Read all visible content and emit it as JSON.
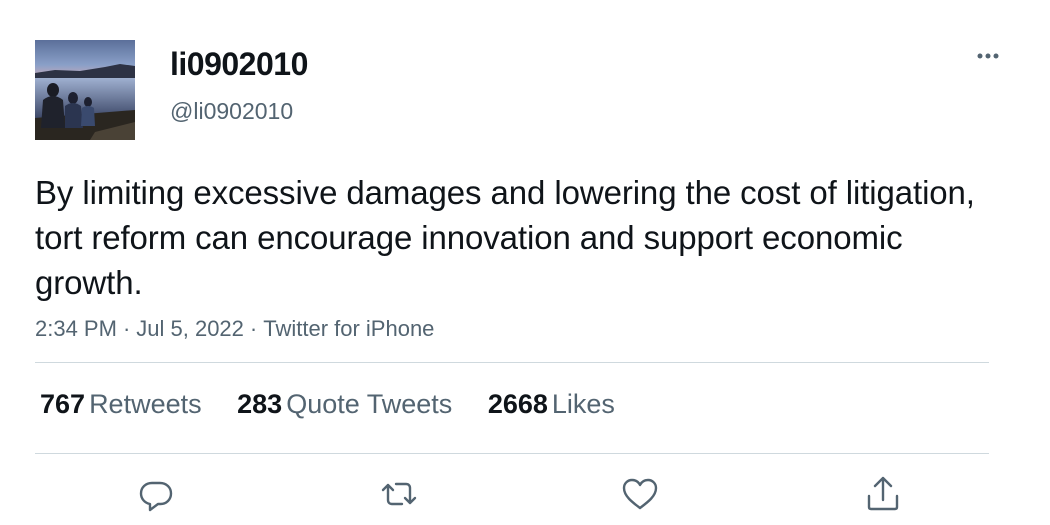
{
  "author": {
    "display_name": "li0902010",
    "handle": "@li0902010"
  },
  "tweet": {
    "text": "By limiting excessive damages and lowering the cost of litigation, tort reform can encourage innovation and support economic growth.",
    "time": "2:34 PM",
    "date": "Jul 5, 2022",
    "source": "Twitter for iPhone",
    "separator": "·"
  },
  "stats": {
    "retweets_count": "767",
    "retweets_label": "Retweets",
    "quotes_count": "283",
    "quotes_label": "Quote Tweets",
    "likes_count": "2668",
    "likes_label": "Likes"
  },
  "icons": {
    "more": "more-horizontal-icon",
    "reply": "reply-icon",
    "retweet": "retweet-icon",
    "like": "heart-icon",
    "share": "share-icon"
  },
  "colors": {
    "text": "#0f1419",
    "secondary": "#536471",
    "divider": "#cfd9de"
  }
}
